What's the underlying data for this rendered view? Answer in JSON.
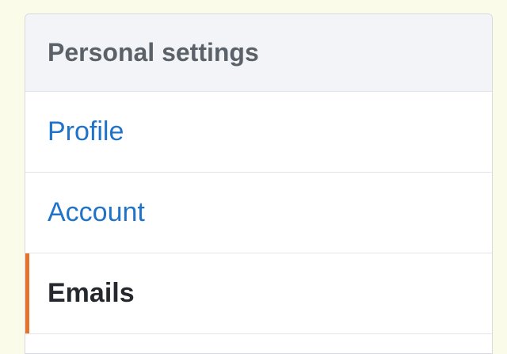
{
  "menu": {
    "heading": "Personal settings",
    "items": [
      {
        "label": "Profile",
        "selected": false
      },
      {
        "label": "Account",
        "selected": false
      },
      {
        "label": "Emails",
        "selected": true
      }
    ]
  },
  "colors": {
    "page_background": "#fbfbe9",
    "link": "#1f73c9",
    "selected_text": "#25292e",
    "selected_indicator": "#e3732d",
    "heading_background": "#f3f4f7",
    "heading_text": "#5b6168"
  }
}
